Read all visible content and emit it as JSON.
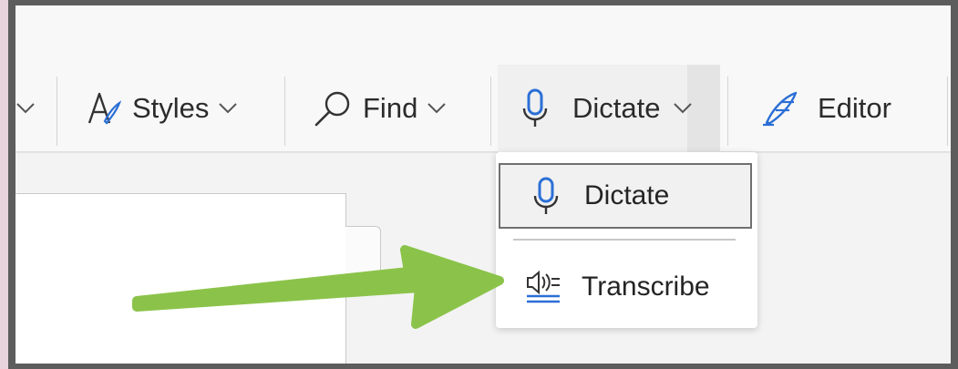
{
  "toolbar": {
    "styles_label": "Styles",
    "find_label": "Find",
    "dictate_label": "Dictate",
    "editor_label": "Editor"
  },
  "dictate_menu": {
    "items": [
      {
        "label": "Dictate",
        "icon": "microphone-icon",
        "selected": true
      },
      {
        "label": "Transcribe",
        "icon": "transcribe-icon",
        "selected": false
      }
    ]
  },
  "colors": {
    "accent_blue": "#2b6fd6",
    "arrow_green": "#8bc34a",
    "frame_border": "#5d5d5d",
    "outer_background": "#e8d4dc"
  },
  "annotation": {
    "type": "arrow",
    "points_to": "Transcribe"
  }
}
